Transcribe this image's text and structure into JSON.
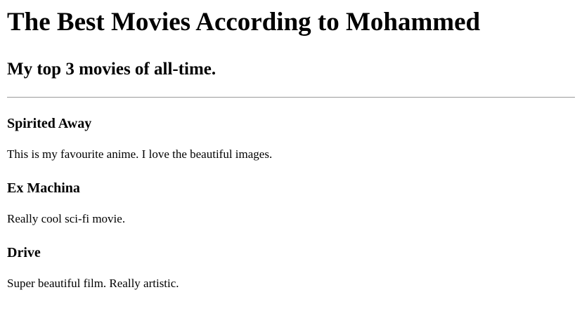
{
  "page": {
    "title": "The Best Movies According to Mohammed",
    "subtitle": "My top 3 movies of all-time."
  },
  "movies": [
    {
      "title": "Spirited Away",
      "description": "This is my favourite anime. I love the beautiful images."
    },
    {
      "title": "Ex Machina",
      "description": "Really cool sci-fi movie."
    },
    {
      "title": "Drive",
      "description": "Super beautiful film. Really artistic."
    }
  ]
}
